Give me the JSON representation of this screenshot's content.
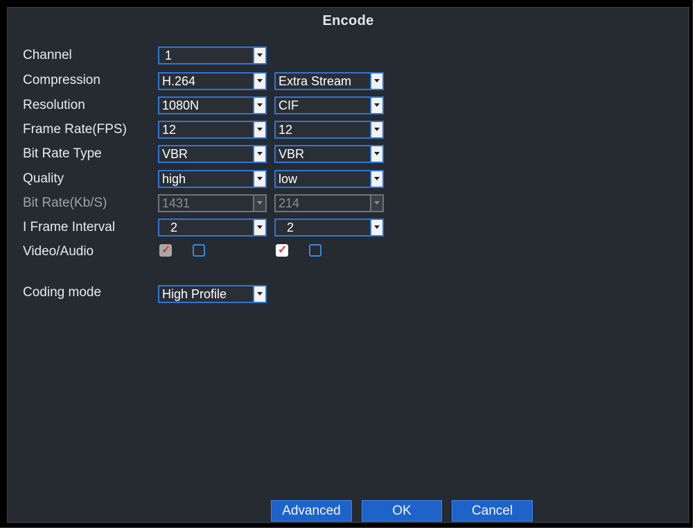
{
  "title": "Encode",
  "labels": {
    "channel": "Channel",
    "compression": "Compression",
    "resolution": "Resolution",
    "frame_rate": "Frame Rate(FPS)",
    "bit_rate_type": "Bit Rate Type",
    "quality": "Quality",
    "bit_rate": "Bit Rate(Kb/S)",
    "i_frame_interval": "I Frame Interval",
    "video_audio": "Video/Audio",
    "coding_mode": "Coding mode"
  },
  "main_stream": {
    "channel": "1",
    "compression": "H.264",
    "resolution": "1080N",
    "frame_rate": "12",
    "bit_rate_type": "VBR",
    "quality": "high",
    "bit_rate": "1431",
    "i_frame_interval": "2",
    "video_checked": true,
    "audio_checked": false
  },
  "extra_stream": {
    "stream": "Extra Stream",
    "resolution": "CIF",
    "frame_rate": "12",
    "bit_rate_type": "VBR",
    "quality": "low",
    "bit_rate": "214",
    "i_frame_interval": "2",
    "video_checked": true,
    "audio_checked": false
  },
  "coding_mode": "High Profile",
  "buttons": {
    "advanced": "Advanced",
    "ok": "OK",
    "cancel": "Cancel"
  },
  "colors": {
    "accent": "#2f77d6",
    "panel": "#262a31",
    "button": "#1e63c9"
  }
}
